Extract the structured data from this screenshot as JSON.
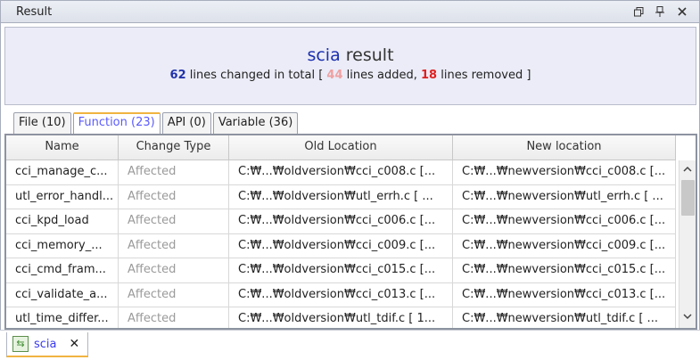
{
  "window": {
    "title": "Result",
    "controls": [
      "restore-icon",
      "pin-icon",
      "close-icon"
    ]
  },
  "summary": {
    "project": "scia",
    "result_word": "result",
    "total": "62",
    "total_text": "lines changed in total [",
    "added": "44",
    "added_text": "lines added,",
    "removed": "18",
    "removed_text": "lines removed ]"
  },
  "tabs": [
    {
      "label": "File (10)",
      "active": false
    },
    {
      "label": "Function (23)",
      "active": true
    },
    {
      "label": "API (0)",
      "active": false
    },
    {
      "label": "Variable (36)",
      "active": false
    }
  ],
  "table": {
    "columns": [
      "Name",
      "Change Type",
      "Old Location",
      "New location"
    ],
    "rows": [
      [
        "cci_manage_c...",
        "Affected",
        "C:₩...₩oldversion₩cci_c008.c [...",
        "C:₩...₩newversion₩cci_c008.c [..."
      ],
      [
        "utl_error_handl...",
        "Affected",
        "C:₩...₩oldversion₩utl_errh.c [ ...",
        "C:₩...₩newversion₩utl_errh.c [ ..."
      ],
      [
        "cci_kpd_load",
        "Affected",
        "C:₩...₩oldversion₩cci_c006.c [...",
        "C:₩...₩newversion₩cci_c006.c [..."
      ],
      [
        "cci_memory_...",
        "Affected",
        "C:₩...₩oldversion₩cci_c009.c [...",
        "C:₩...₩newversion₩cci_c009.c [..."
      ],
      [
        "cci_cmd_fram...",
        "Affected",
        "C:₩...₩oldversion₩cci_c015.c [...",
        "C:₩...₩newversion₩cci_c015.c [..."
      ],
      [
        "cci_validate_a...",
        "Affected",
        "C:₩...₩oldversion₩cci_c013.c [...",
        "C:₩...₩newversion₩cci_c013.c [..."
      ],
      [
        "utl_time_differ...",
        "Affected",
        "C:₩...₩oldversion₩utl_tdif.c [ 1...",
        "C:₩...₩newversion₩utl_tdif.c [ ..."
      ]
    ]
  },
  "editor_tab": {
    "label": "scia",
    "icon": "compare-icon",
    "close": "✕"
  },
  "colors": {
    "project": "#1a2fb0",
    "total": "#2233aa",
    "added": "#f0a0a0",
    "removed": "#e02020",
    "active_tab": "#5a5aff",
    "accent": "#f0b440"
  }
}
